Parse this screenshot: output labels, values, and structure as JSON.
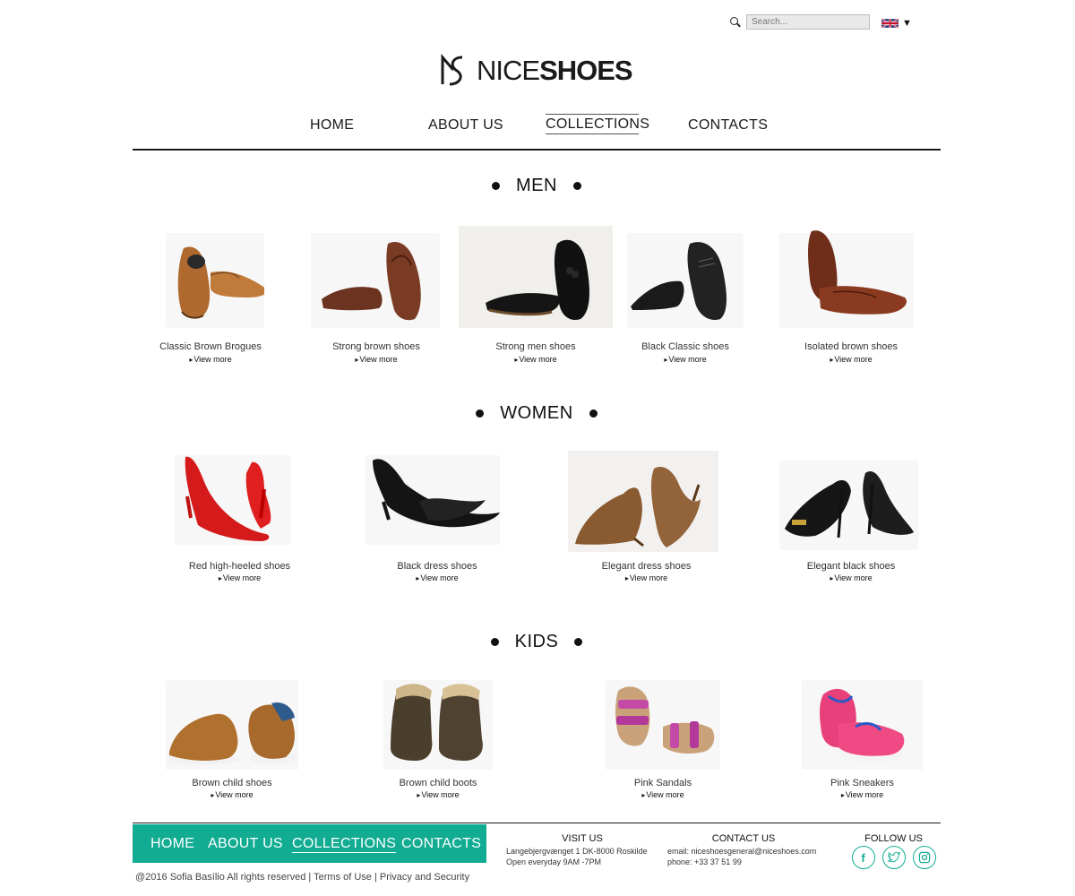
{
  "header": {
    "search_placeholder": "Search...",
    "language": "English",
    "logo_light": "NICE",
    "logo_bold": "SHOES"
  },
  "nav": {
    "items": [
      {
        "label": "HOME"
      },
      {
        "label": "ABOUT US"
      },
      {
        "label": "COLLECTIONS",
        "active": true
      },
      {
        "label": "CONTACTS"
      }
    ]
  },
  "sections": {
    "men": {
      "title": "MEN",
      "products": [
        {
          "name": "Classic Brown Brogues",
          "link": "View more"
        },
        {
          "name": "Strong brown shoes",
          "link": "View more"
        },
        {
          "name": "Strong men shoes",
          "link": "View more"
        },
        {
          "name": "Black Classic shoes",
          "link": "View more"
        },
        {
          "name": "Isolated brown shoes",
          "link": "View more"
        }
      ]
    },
    "women": {
      "title": "WOMEN",
      "products": [
        {
          "name": "Red high-heeled shoes",
          "link": "View more"
        },
        {
          "name": "Black dress shoes",
          "link": "View more"
        },
        {
          "name": "Elegant dress shoes",
          "link": "View more"
        },
        {
          "name": "Elegant black shoes",
          "link": "View more"
        }
      ]
    },
    "kids": {
      "title": "KIDS",
      "products": [
        {
          "name": "Brown child shoes",
          "link": "View more"
        },
        {
          "name": "Brown child boots",
          "link": "View more"
        },
        {
          "name": "Pink Sandals",
          "link": "View more"
        },
        {
          "name": "Pink Sneakers",
          "link": "View more"
        }
      ]
    }
  },
  "footer": {
    "nav": [
      {
        "label": "HOME"
      },
      {
        "label": "ABOUT US"
      },
      {
        "label": "COLLECTIONS",
        "active": true
      },
      {
        "label": "CONTACTS"
      }
    ],
    "copyright": "@2016 Sofia Basílio All rights reserved | Terms of Use | Privacy and Security",
    "visit": {
      "title": "VISIT US",
      "address": "Langebjergvænget 1 DK-8000 Roskilde",
      "hours": "Open everyday 9AM -7PM"
    },
    "contact": {
      "title": "CONTACT US",
      "email": "email: niceshoesgeneral@niceshoes.com",
      "phone": "phone: +33 37 51 99"
    },
    "follow": {
      "title": "FOLLOW US",
      "icons": [
        "facebook-icon",
        "twitter-icon",
        "instagram-icon"
      ]
    }
  },
  "colors": {
    "accent": "#12ac93",
    "text": "#1a1a1a"
  }
}
